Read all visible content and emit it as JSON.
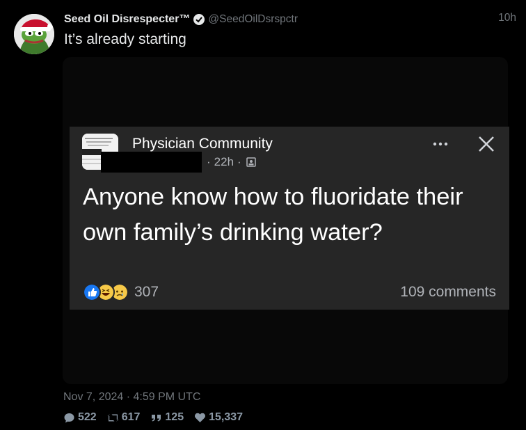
{
  "tweet": {
    "display_name": "Seed Oil Disrespecter™",
    "handle": "@SeedOilDsrspctr",
    "time": "10h",
    "text": "It’s already starting",
    "date": "Nov 7, 2024 · 4:59 PM UTC",
    "stats": {
      "replies": "522",
      "retweets": "617",
      "quotes": "125",
      "likes": "15,337"
    }
  },
  "embed": {
    "group_name": "Physician Community",
    "logo_text": "PHYSICIAN",
    "meta_time": "22h",
    "post_text": "Anyone know how to fluoridate their own family’s drinking water?",
    "reaction_count": "307",
    "comments": "109 comments"
  },
  "colors": {
    "background": "#000000",
    "embed_background": "#262626",
    "muted_text": "#71767b",
    "verified_badge": "#e7e9ea"
  }
}
